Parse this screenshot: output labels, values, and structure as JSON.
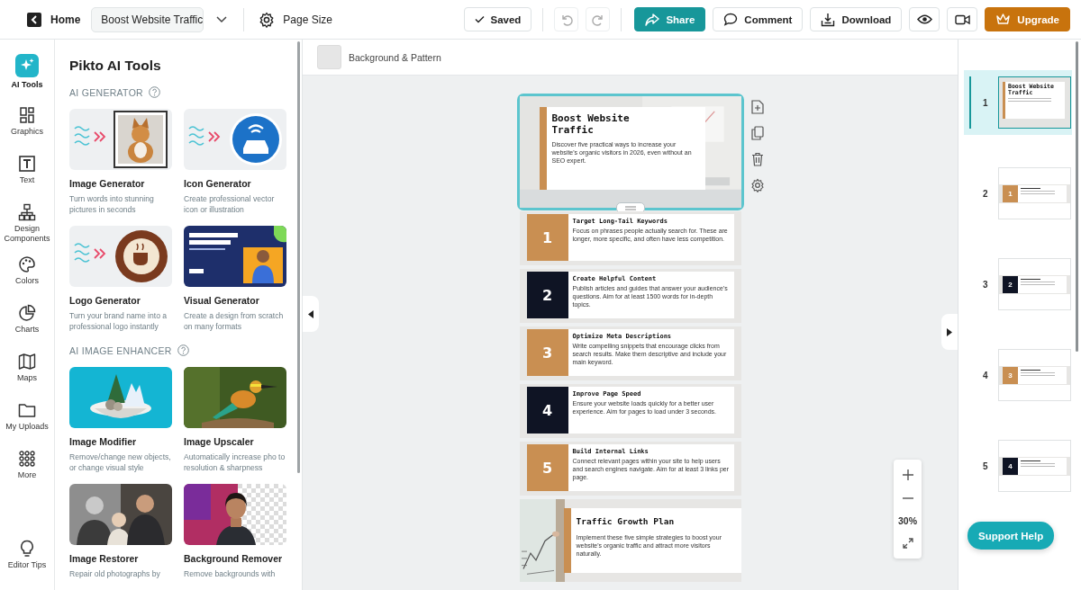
{
  "topbar": {
    "home": "Home",
    "document_title": "Boost Website Traffic",
    "page_size": "Page Size",
    "saved": "Saved",
    "share": "Share",
    "comment": "Comment",
    "download": "Download",
    "upgrade": "Upgrade"
  },
  "rail": [
    {
      "kind": "ai",
      "label": "AI Tools",
      "selected": true
    },
    {
      "kind": "graphics",
      "label": "Graphics",
      "selected": false
    },
    {
      "kind": "text",
      "label": "Text",
      "selected": false
    },
    {
      "kind": "components",
      "label": "Design Components",
      "selected": false
    },
    {
      "kind": "colors",
      "label": "Colors",
      "selected": false
    },
    {
      "kind": "charts",
      "label": "Charts",
      "selected": false
    },
    {
      "kind": "maps",
      "label": "Maps",
      "selected": false
    },
    {
      "kind": "uploads",
      "label": "My Uploads",
      "selected": false
    },
    {
      "kind": "more",
      "label": "More",
      "selected": false
    },
    {
      "kind": "tips",
      "label": "Editor Tips",
      "selected": false
    }
  ],
  "panel": {
    "title": "Pikto AI Tools",
    "sections": [
      {
        "heading": "AI GENERATOR",
        "tools": [
          {
            "name": "Image Generator",
            "description": "Turn words into stunning pictures in seconds"
          },
          {
            "name": "Icon Generator",
            "description": "Create professional vector icon or illustration"
          },
          {
            "name": "Logo Generator",
            "description": "Turn your brand name into a professional logo instantly"
          },
          {
            "name": "Visual Generator",
            "description": "Create a design from scratch on many formats"
          }
        ]
      },
      {
        "heading": "AI IMAGE ENHANCER",
        "tools": [
          {
            "name": "Image Modifier",
            "description": "Remove/change new objects, or change visual style"
          },
          {
            "name": "Image Upscaler",
            "description": "Automatically increase pho to resolution & sharpness"
          },
          {
            "name": "Image Restorer",
            "description": "Repair old photographs by"
          },
          {
            "name": "Background Remover",
            "description": "Remove backgrounds with"
          }
        ]
      }
    ]
  },
  "canvas": {
    "background_pattern": "Background & Pattern",
    "zoom": "30%",
    "slides": [
      {
        "kind": "title",
        "selected": true,
        "title": "Boost Website Traffic",
        "text": "Discover five practical ways to increase your website's organic visitors in 2026, even without an SEO expert."
      },
      {
        "kind": "step",
        "selected": false,
        "number": "1",
        "color": "#c98f52",
        "title": "Target Long-Tail Keywords",
        "text": "Focus on phrases people actually search for. These are longer, more specific, and often have less competition."
      },
      {
        "kind": "step",
        "selected": false,
        "number": "2",
        "color": "#0f1424",
        "title": "Create Helpful Content",
        "text": "Publish articles and guides that answer your audience's questions. Aim for at least 1500 words for in-depth topics."
      },
      {
        "kind": "step",
        "selected": false,
        "number": "3",
        "color": "#c98f52",
        "title": "Optimize Meta Descriptions",
        "text": "Write compelling snippets that encourage clicks from search results. Make them descriptive and include your main keyword."
      },
      {
        "kind": "step",
        "selected": false,
        "number": "4",
        "color": "#0f1424",
        "title": "Improve Page Speed",
        "text": "Ensure your website loads quickly for a better user experience. Aim for pages to load under 3 seconds."
      },
      {
        "kind": "step",
        "selected": false,
        "number": "5",
        "color": "#c98f52",
        "title": "Build Internal Links",
        "text": "Connect relevant pages within your site to help users and search engines navigate. Aim for at least 3 links per page."
      },
      {
        "kind": "closing",
        "selected": false,
        "title": "Traffic Growth Plan",
        "text": "Implement these five simple strategies to boost your website's organic traffic and attract more visitors naturally."
      }
    ]
  },
  "thumbnails": [
    {
      "number": "1",
      "selected": true,
      "kind": "title",
      "title": "Boost Website Traffic"
    },
    {
      "number": "2",
      "selected": false,
      "kind": "step",
      "badge": "1",
      "color": "#c98f52"
    },
    {
      "number": "3",
      "selected": false,
      "kind": "step",
      "badge": "2",
      "color": "#0f1424"
    },
    {
      "number": "4",
      "selected": false,
      "kind": "step",
      "badge": "3",
      "color": "#c98f52"
    },
    {
      "number": "5",
      "selected": false,
      "kind": "step",
      "badge": "4",
      "color": "#0f1424"
    }
  ],
  "support": "Support Help"
}
